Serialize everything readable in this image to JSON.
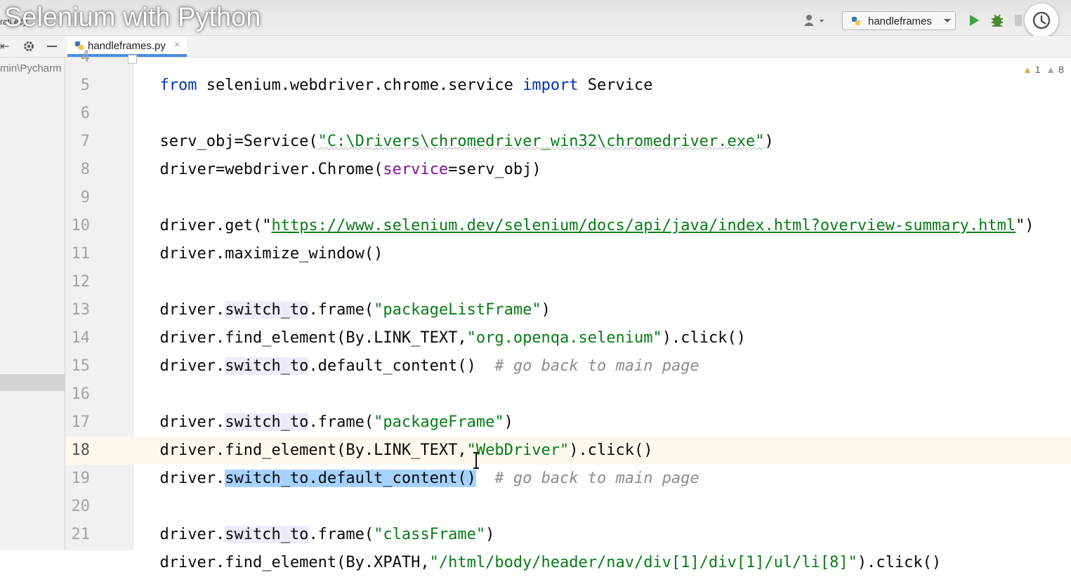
{
  "video": {
    "title": "Selenium with Python"
  },
  "toolbar": {
    "fragment_label": "rati   ecy",
    "run_config_label": "handleframes"
  },
  "tabs": [
    {
      "label": "handleframes.py",
      "close": "×"
    }
  ],
  "sidebar": {
    "path": "min\\Pycharm"
  },
  "inspections": {
    "warnings": "1",
    "weak_warnings": "8",
    "warn_glyph": "▲"
  },
  "editor": {
    "current_line": "18",
    "lines": [
      {
        "num": "4",
        "text": "from selenium.webdriver.chrome.service import Service"
      },
      {
        "num": "5",
        "text": ""
      },
      {
        "num": "6",
        "text": "serv_obj=Service(\"C:\\Drivers\\chromedriver_win32\\chromedriver.exe\")"
      },
      {
        "num": "7",
        "text": "driver=webdriver.Chrome(service=serv_obj)"
      },
      {
        "num": "8",
        "text": ""
      },
      {
        "num": "9",
        "text": "driver.get(\"https://www.selenium.dev/selenium/docs/api/java/index.html?overview-summary.html\")"
      },
      {
        "num": "10",
        "text": "driver.maximize_window()"
      },
      {
        "num": "11",
        "text": ""
      },
      {
        "num": "12",
        "text": "driver.switch_to.frame(\"packageListFrame\")"
      },
      {
        "num": "13",
        "text": "driver.find_element(By.LINK_TEXT,\"org.openqa.selenium\").click()"
      },
      {
        "num": "14",
        "text": "driver.switch_to.default_content()  # go back to main page"
      },
      {
        "num": "15",
        "text": ""
      },
      {
        "num": "16",
        "text": "driver.switch_to.frame(\"packageFrame\")"
      },
      {
        "num": "17",
        "text": "driver.find_element(By.LINK_TEXT,\"WebDriver\").click()"
      },
      {
        "num": "18",
        "text": "driver.switch_to.default_content()  # go back to main page"
      },
      {
        "num": "19",
        "text": ""
      },
      {
        "num": "20",
        "text": "driver.switch_to.frame(\"classFrame\")"
      },
      {
        "num": "21",
        "text": "driver.find_element(By.XPATH,\"/html/body/header/nav/div[1]/div[1]/ul/li[8]\").click()"
      }
    ],
    "tokens": {
      "l4": [
        "from",
        " selenium.webdriver.chrome.service ",
        "import",
        " Service"
      ],
      "l6": [
        "serv_obj=Service(",
        "\"C:\\Drivers\\chromedriver_win32\\chromedriver.exe\"",
        ")"
      ],
      "l7": [
        "driver",
        "=webdriver.Chrome(",
        "service",
        "=serv_obj)"
      ],
      "l9": [
        "driver.get(\"",
        "https://www.selenium.dev/selenium/docs/api/java/index.html?overview-summary.html",
        "\")"
      ],
      "l10": [
        "driver.maximize_window()"
      ],
      "l12": [
        "driver.",
        "switch_to",
        ".frame(",
        "\"packageListFrame\"",
        ")"
      ],
      "l13": [
        "driver.find_element(By.LINK_TEXT,",
        "\"org.openqa.selenium\"",
        ").click()"
      ],
      "l14": [
        "driver.",
        "switch_to",
        ".default_content()",
        "  ",
        "# go back to main page"
      ],
      "l16": [
        "driver.",
        "switch_to",
        ".frame(",
        "\"packageFrame\"",
        ")"
      ],
      "l17": [
        "driver.find_element(By.LINK_TEXT,",
        "\"WebDriver\"",
        ").click()"
      ],
      "l18": [
        "driver.",
        "switch_to.default_content()",
        "  ",
        "# go back to main page"
      ],
      "l20": [
        "driver.",
        "switch_to",
        ".frame(",
        "\"classFrame\"",
        ")"
      ],
      "l21": [
        "driver.find_element(By.XPATH,",
        "\"/html/body/header/nav/div[1]/div[1]/ul/li[8]\"",
        ").click()"
      ]
    }
  },
  "colors": {
    "string": "#067d17",
    "keyword": "#0033b3",
    "keyword_arg": "#871094",
    "comment": "#8c8c8c",
    "identifier_highlight": "#edebfc",
    "selection": "#a6d2ff",
    "tab_underline": "#4b8de0"
  },
  "icons": [
    "user-icon",
    "python-icon",
    "chevron-down-icon",
    "run-icon",
    "debug-icon",
    "clock-icon",
    "gear-icon",
    "minimize-icon",
    "close-icon",
    "warning-icon",
    "text-cursor-icon"
  ]
}
